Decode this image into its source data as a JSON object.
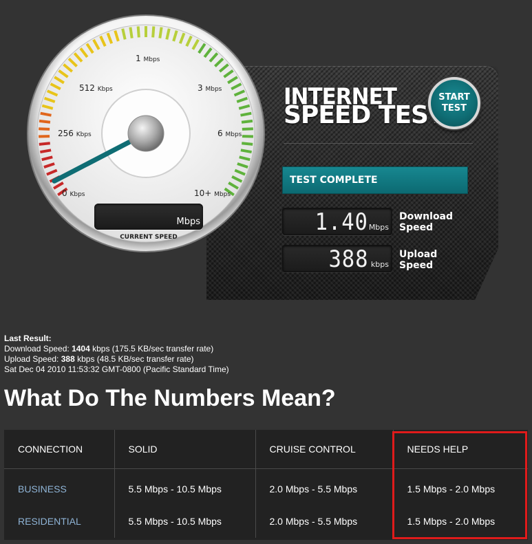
{
  "widget": {
    "title_line1": "INTERNET",
    "title_line2": "SPEED TEST",
    "start_button": {
      "line1": "START",
      "line2": "TEST"
    },
    "status": "TEST COMPLETE",
    "download": {
      "value": "1.40",
      "unit": "Mbps",
      "label_line1": "Download",
      "label_line2": "Speed"
    },
    "upload": {
      "value": "388",
      "unit": "kbps",
      "label_line1": "Upload",
      "label_line2": "Speed"
    },
    "gauge": {
      "labels": [
        {
          "value": "0",
          "unit": "Kbps"
        },
        {
          "value": "256",
          "unit": "Kbps"
        },
        {
          "value": "512",
          "unit": "Kbps"
        },
        {
          "value": "1",
          "unit": "Mbps"
        },
        {
          "value": "3",
          "unit": "Mbps"
        },
        {
          "value": "6",
          "unit": "Mbps"
        },
        {
          "value": "10+",
          "unit": "Mbps"
        }
      ],
      "needle_level_fraction": 0.03,
      "current_speed_unit": "Mbps",
      "current_speed_label": "CURRENT SPEED",
      "accent_color": "#0f6d74"
    }
  },
  "last_result": {
    "header": "Last Result:",
    "download_prefix": "Download Speed: ",
    "download_value": "1404",
    "download_suffix": " kbps (175.5 KB/sec transfer rate)",
    "upload_prefix": "Upload Speed: ",
    "upload_value": "388",
    "upload_suffix": " kbps (48.5 KB/sec transfer rate)",
    "timestamp": "Sat Dec 04 2010 11:53:32 GMT-0800 (Pacific Standard Time)"
  },
  "heading": "What Do The Numbers Mean?",
  "table": {
    "headers": [
      "CONNECTION",
      "SOLID",
      "CRUISE CONTROL",
      "NEEDS HELP"
    ],
    "rows": [
      [
        "BUSINESS",
        "5.5 Mbps - 10.5 Mbps",
        "2.0 Mbps - 5.5 Mbps",
        "1.5 Mbps - 2.0 Mbps"
      ],
      [
        "RESIDENTIAL",
        "5.5 Mbps - 10.5 Mbps",
        "2.0 Mbps - 5.5 Mbps",
        "1.5 Mbps - 2.0 Mbps"
      ]
    ],
    "highlight_color": "#e01b1b"
  }
}
